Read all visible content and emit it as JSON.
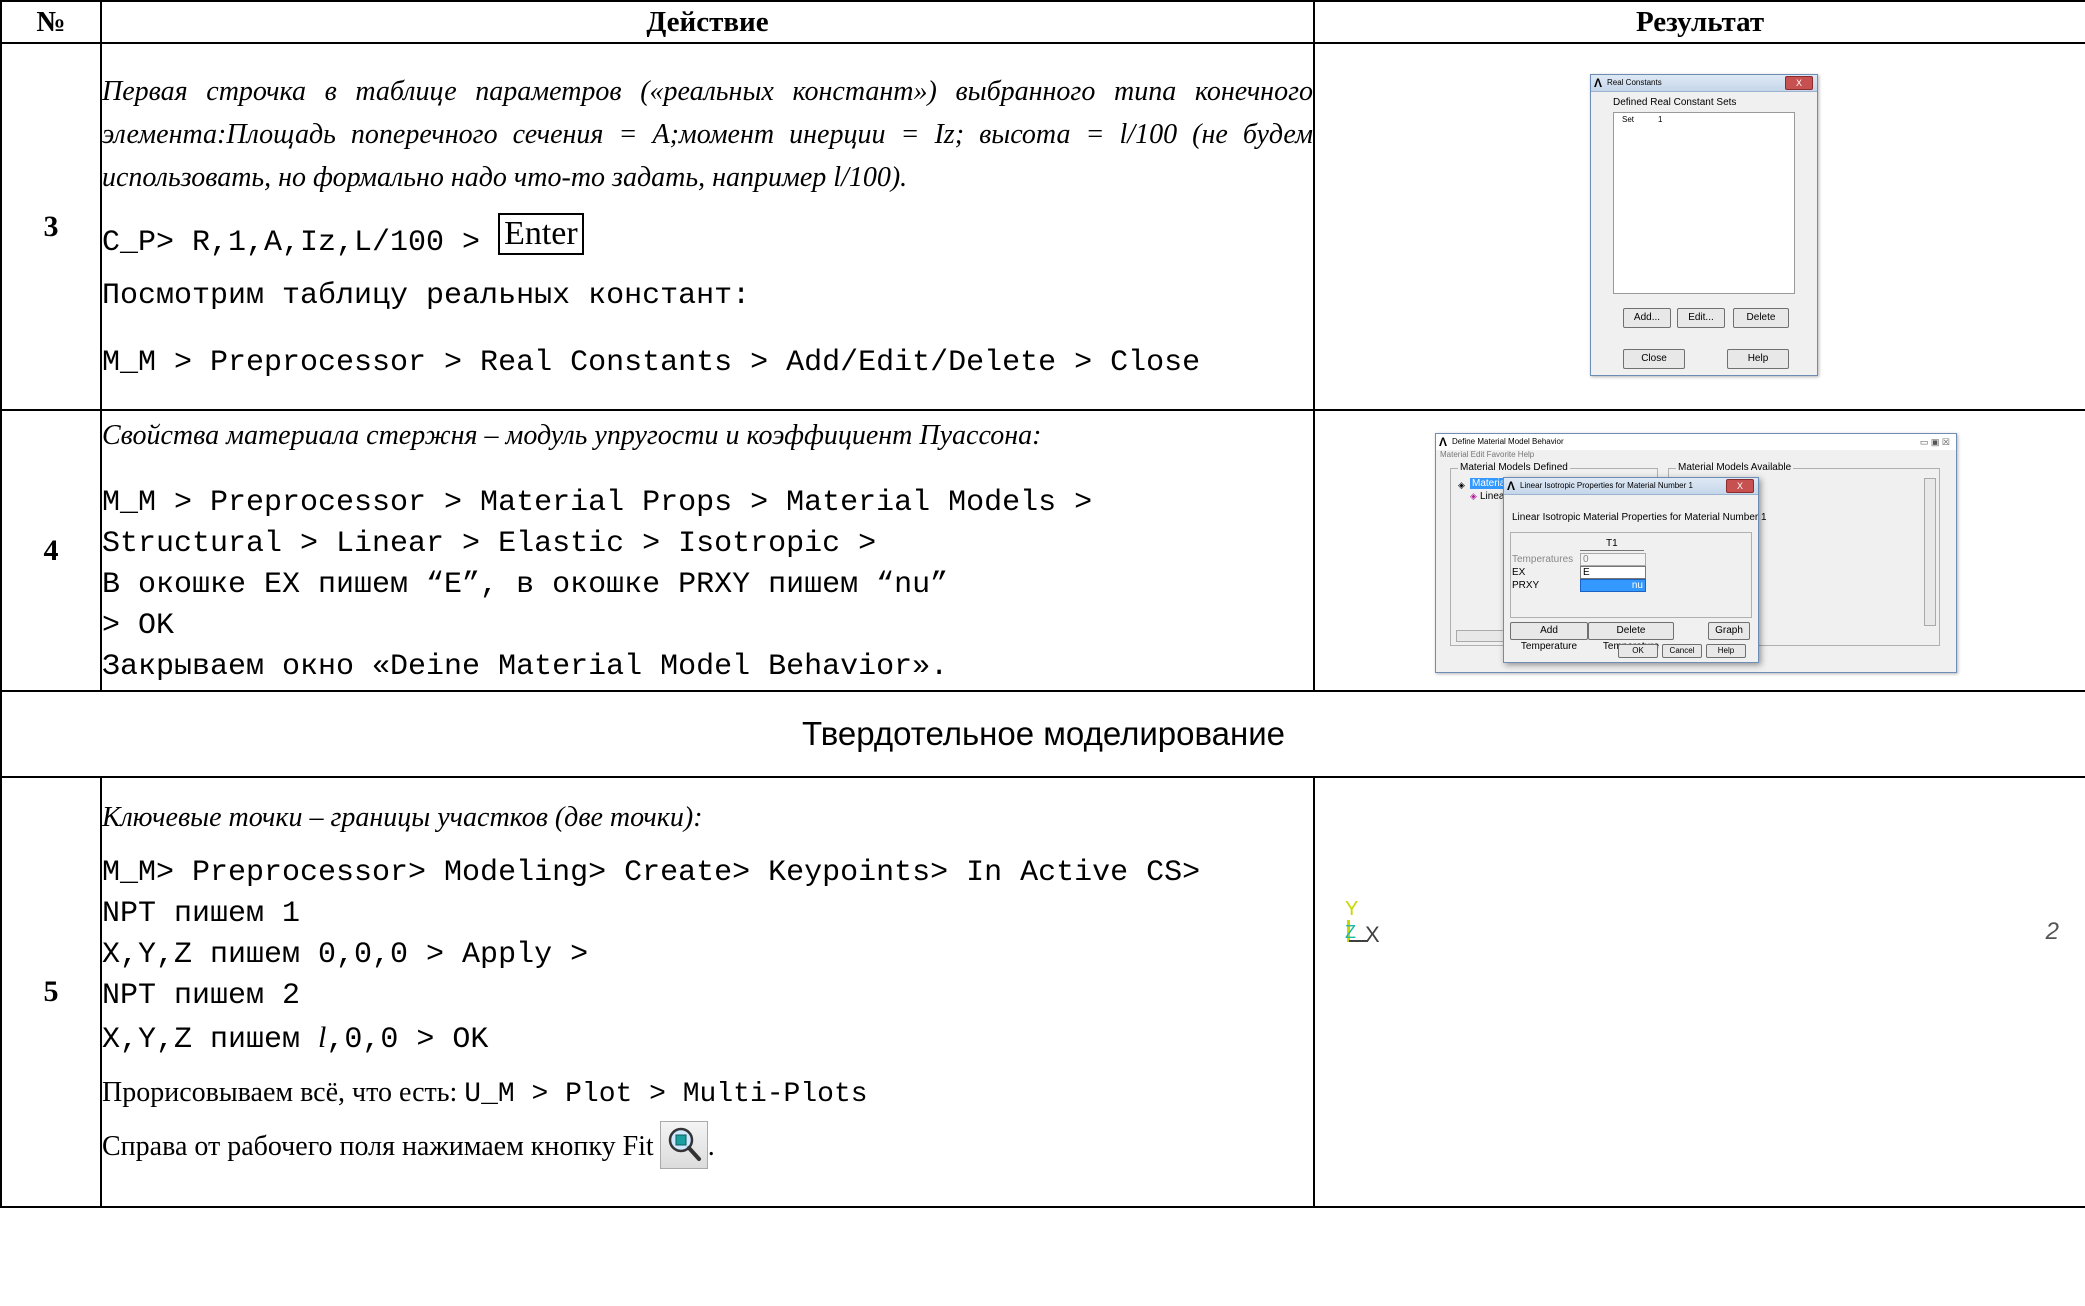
{
  "header": {
    "num": "№",
    "action": "Действие",
    "result": "Результат"
  },
  "row3": {
    "num": "3",
    "intro": "Первая строчка в таблице параметров («реальных констант») выбранного типа конечного элемента:Площадь поперечного сечения = A;момент инерции = Iz; высота = l/100 (не будем использовать, но формально надо что-то задать, например l/100).",
    "cmd": "C_P> R,1,A,Iz,L/100 > ",
    "enter": "Enter",
    "view": "Посмотрим таблицу реальных констант:",
    "path": "M_M > Preprocessor > Real Constants > Add/Edit/Delete > Close"
  },
  "real_constants_dialog": {
    "title": "Real Constants",
    "close": "X",
    "group_label": "Defined Real Constant Sets",
    "list_item_set": "Set",
    "list_item_num": "1",
    "add": "Add...",
    "edit": "Edit...",
    "delete": "Delete",
    "close_btn": "Close",
    "help": "Help"
  },
  "row4": {
    "num": "4",
    "intro": "Свойства материала стержня – модуль упругости и коэффициент Пуассона:",
    "line1": "M_M > Preprocessor > Material Props > Material Models >",
    "line2": "Structural > Linear > Elastic > Isotropic >",
    "line3": "В окошке EX пишем “E”, в окошке PRXY пишем “nu”",
    "line4": "> OK",
    "line5": "Закрываем окно «Deine Material Model Behavior»."
  },
  "material_dialog": {
    "title": "Define Material Model Behavior",
    "menu": "Material   Edit   Favorite   Help",
    "defined": "Material Models Defined",
    "available": "Material Models Available",
    "tree_item": "Material M",
    "tree_sub": "Linear",
    "win_controls": "▭ ▣ ☒"
  },
  "iso_dialog": {
    "title": "Linear Isotropic Properties for Material Number 1",
    "close": "X",
    "heading": "Linear Isotropic Material Properties for Material Number 1",
    "col": "T1",
    "temps_label": "Temperatures",
    "temps_val": "0",
    "ex_label": "EX",
    "ex_val": "E",
    "prxy_label": "PRXY",
    "prxy_val": "nu",
    "add_temp": "Add Temperature",
    "del_temp": "Delete Temperature",
    "graph": "Graph",
    "ok": "OK",
    "cancel": "Cancel",
    "help": "Help"
  },
  "section": {
    "title": "Твердотельное моделирование"
  },
  "row5": {
    "num": "5",
    "intro": "Ключевые точки – границы участков (две точки):",
    "line1": "M_M> Preprocessor> Modeling> Create> Keypoints> In Active CS>",
    "line2": "NPT пишем 1",
    "line3": "X,Y,Z пишем 0,0,0 > Apply >",
    "line4": "NPT пишем 2",
    "line5a": "X,Y,Z пишем ",
    "line5b": "l",
    "line5c": ",0,0 > OK",
    "plot_text": "Прорисовываем всё, что есть: ",
    "plot_cmd": "U_M > Plot > Multi-Plots",
    "fit_text": "Справа от рабочего поля нажимаем кнопку Fit",
    "fit_end": "."
  },
  "result5": {
    "axis_y": "Y",
    "axis_x": "X",
    "axis_z": "Z",
    "keypoint_label": "2",
    "colors": {
      "y_axis": "#c8d800",
      "z_axis": "#20b8a0",
      "x_axis": "#404040"
    }
  }
}
